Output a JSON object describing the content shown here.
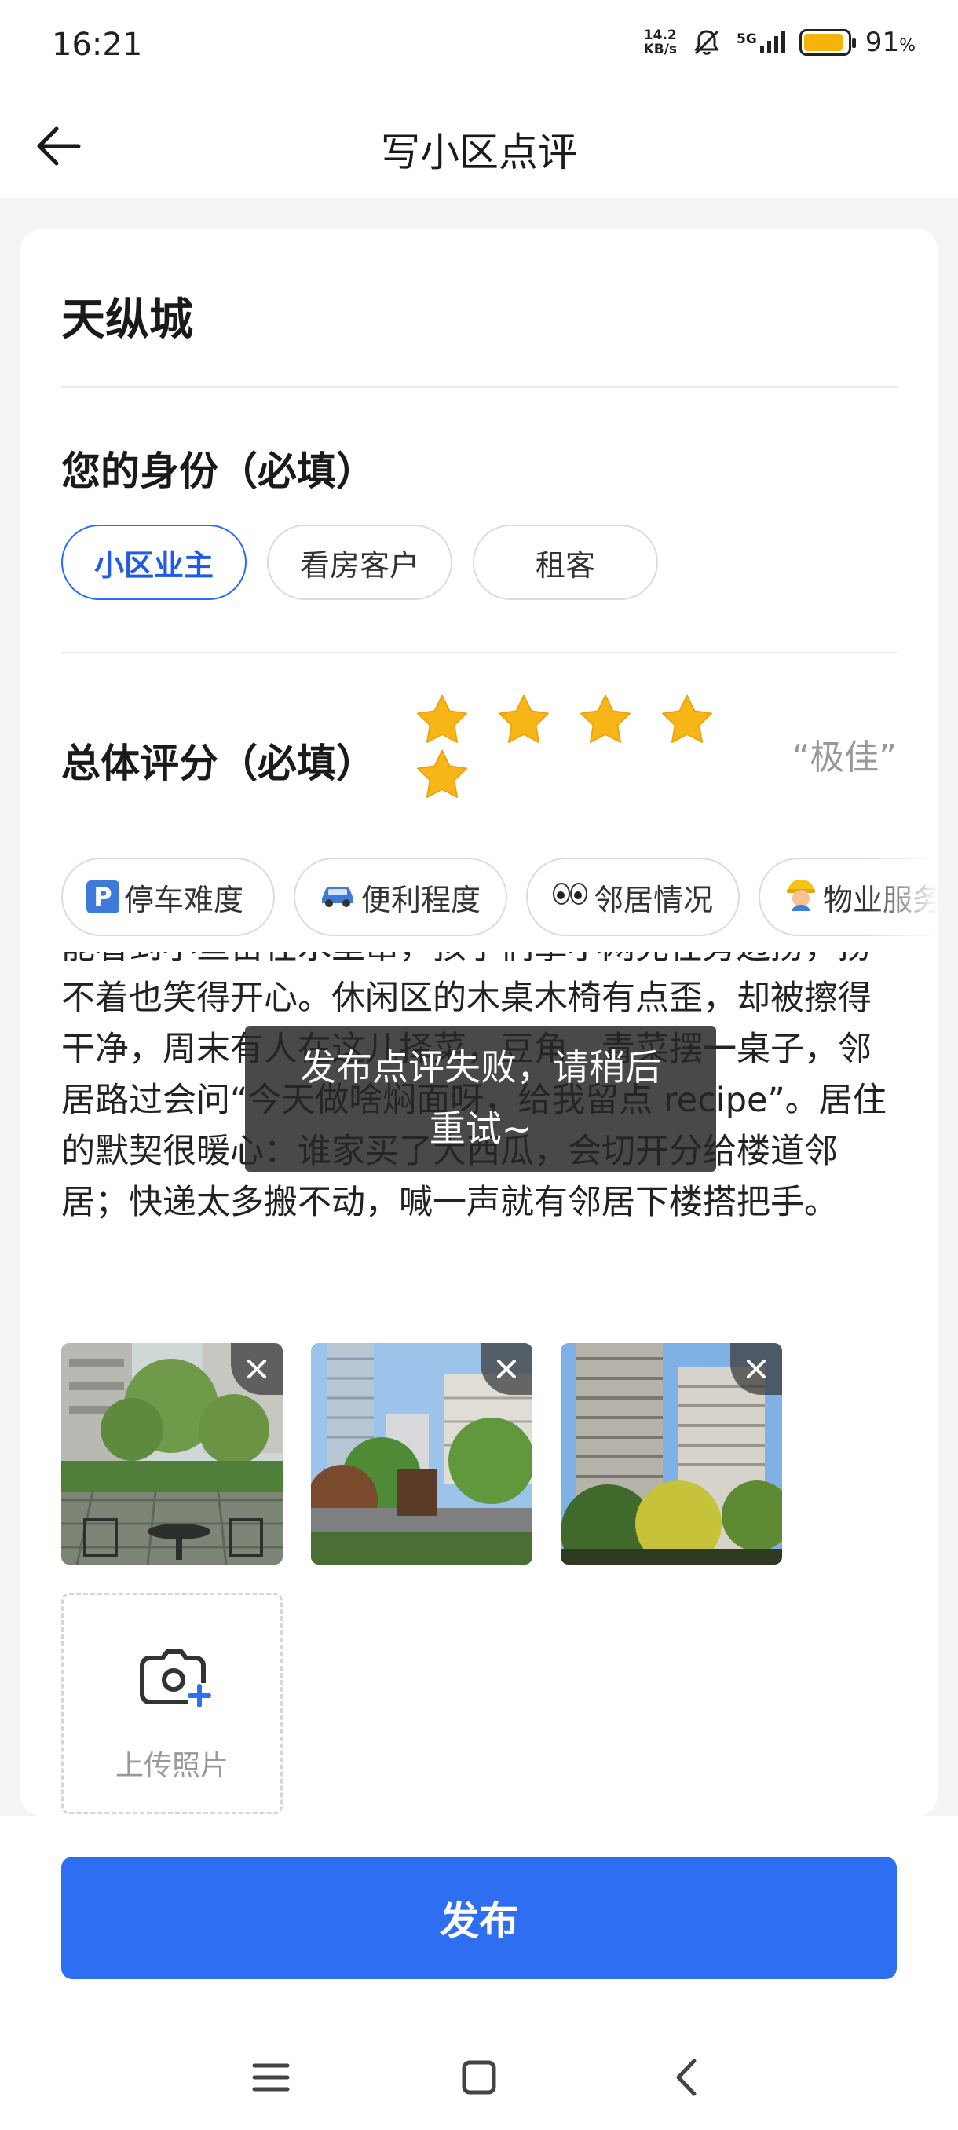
{
  "status_bar": {
    "time": "16:21",
    "net_speed_value": "14.2",
    "net_speed_unit": "KB/s",
    "network": "5G",
    "battery_percent": "91",
    "battery_level": 0.91
  },
  "nav": {
    "title": "写小区点评"
  },
  "community": {
    "name": "天纵城"
  },
  "identity": {
    "title": "您的身份（必填）",
    "options": [
      "小区业主",
      "看房客户",
      "租客"
    ],
    "selected": "小区业主"
  },
  "rating": {
    "title": "总体评分（必填）",
    "stars": 5,
    "max_stars": 5,
    "label": "“极佳”"
  },
  "aspect_tags": [
    {
      "emoji_icon": "parking-sign",
      "label": "停车难度"
    },
    {
      "emoji_icon": "car",
      "label": "便利程度"
    },
    {
      "emoji_icon": "eyes",
      "label": "邻居情况"
    },
    {
      "emoji_icon": "construction-worker",
      "label": "物业服务"
    }
  ],
  "review": {
    "text": "能看到小鱼苗在水里窜，孩子们拿小网兜在旁边捞，捞不着也笑得开心。休闲区的木桌木椅有点歪，却被擦得干净，周末有人在这儿择菜，豆角、青菜摆一桌子，邻居路过会问“今天做啥焖面呀，给我留点 recipe”。居住的默契很暖心：谁家买了大西瓜，会切开分给楼道邻居；快递太多搬不动，喊一声就有邻居下楼搭把手。"
  },
  "photos": [
    {
      "name": "garden-patio-photo"
    },
    {
      "name": "courtyard-trees-photo"
    },
    {
      "name": "tower-buildings-photo"
    }
  ],
  "upload": {
    "label": "上传照片"
  },
  "toast": {
    "line1": "发布点评失败，请稍后",
    "line2": "重试~"
  },
  "publish": {
    "label": "发布"
  },
  "colors": {
    "accent": "#2e6ff2",
    "star": "#f8b616",
    "battery": "#f5b40a"
  }
}
